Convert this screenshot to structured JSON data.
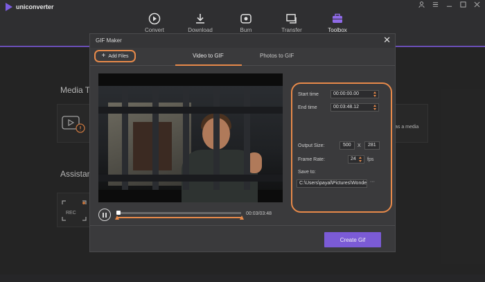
{
  "app": {
    "name": "uniconverter",
    "accent": "#7b5bd6",
    "highlight": "#e88a4a"
  },
  "nav": {
    "items": [
      {
        "label": "Convert",
        "icon": "convert-icon"
      },
      {
        "label": "Download",
        "icon": "download-icon"
      },
      {
        "label": "Burn",
        "icon": "burn-icon"
      },
      {
        "label": "Transfer",
        "icon": "transfer-icon"
      },
      {
        "label": "Toolbox",
        "icon": "toolbox-icon",
        "active": true
      }
    ]
  },
  "background": {
    "section1": "Media To",
    "section2": "Assistan",
    "card_text": "as a media"
  },
  "dialog": {
    "title": "GIF Maker",
    "add_files": "Add Files",
    "tabs": [
      "Video to GIF",
      "Photos to GIF"
    ],
    "active_tab": 0,
    "player": {
      "time": "00:03/03:48",
      "state": "paused"
    },
    "settings": {
      "start_time_label": "Start time",
      "start_time": "00:00:00.00",
      "end_time_label": "End time",
      "end_time": "00:03:48.12",
      "output_size_label": "Output Size:",
      "width": "500",
      "x_sep": "X",
      "height": "281",
      "frame_rate_label": "Frame Rate:",
      "frame_rate": "24",
      "fps": "fps",
      "save_to_label": "Save to:",
      "save_path": "C:\\Users\\payal\\Pictures\\Wonde",
      "more": "···"
    },
    "create_button": "Create Gif"
  }
}
